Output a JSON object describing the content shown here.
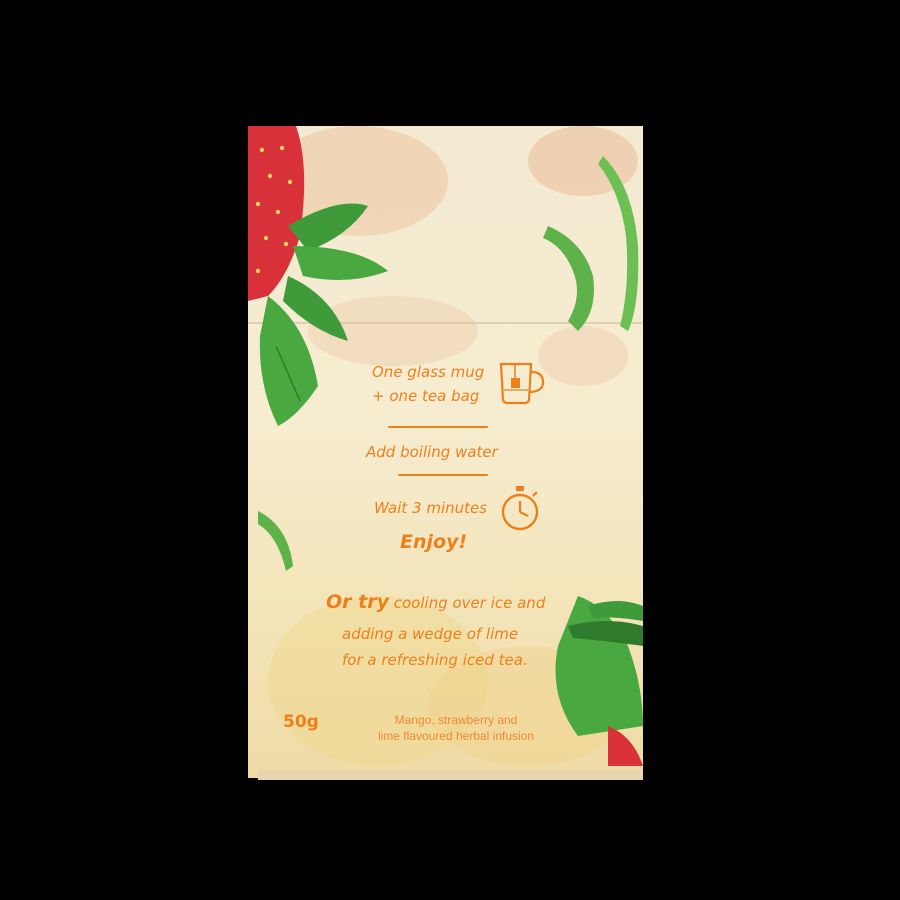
{
  "product": {
    "step1_line1": "One glass mug",
    "step1_line2": "+ one tea bag",
    "step2": "Add boiling water",
    "step3": "Wait 3 minutes",
    "step4": "Enjoy!",
    "alt_lead": "Or try",
    "alt_line1_rest": " cooling over ice and",
    "alt_line2": "adding a wedge of lime",
    "alt_line3": "for a refreshing iced tea.",
    "weight": "50g",
    "desc_line1": "Mango, strawberry and",
    "desc_line2": "lime flavoured herbal infusion"
  },
  "colors": {
    "background": "#000000",
    "box": "#f4ead2",
    "accent_orange": "#ee7f1b",
    "strawberry": "#d9313a",
    "leaf": "#3f9a3a"
  },
  "icons": [
    "mug-icon",
    "stopwatch-icon"
  ]
}
